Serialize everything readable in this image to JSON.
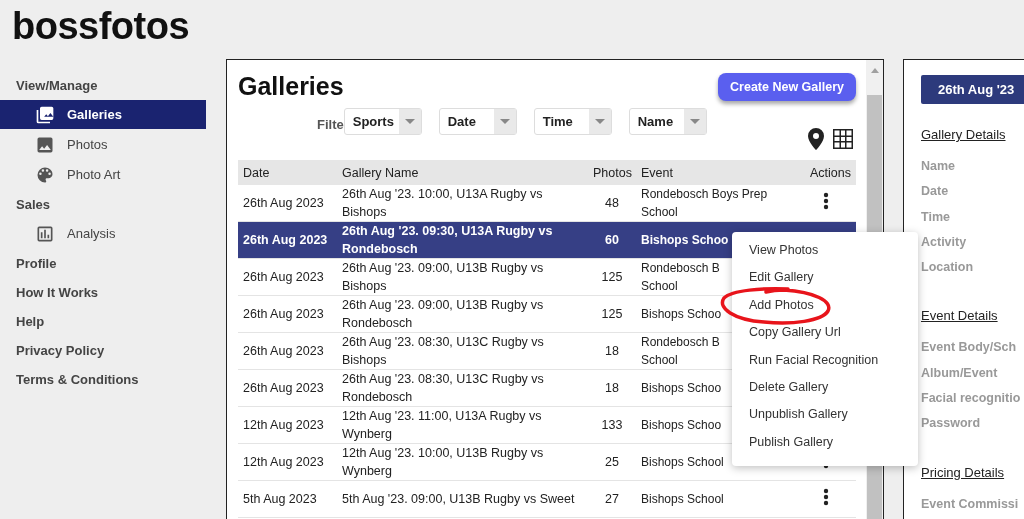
{
  "logo": "bossfotos",
  "sidebar": {
    "sections": [
      {
        "label": "View/Manage",
        "items": [
          {
            "label": "Galleries",
            "selected": true
          },
          {
            "label": "Photos",
            "selected": false
          },
          {
            "label": "Photo Art",
            "selected": false
          }
        ]
      },
      {
        "label": "Sales",
        "items": [
          {
            "label": "Analysis",
            "selected": false
          }
        ]
      },
      {
        "label": "Profile"
      },
      {
        "label": "How It Works"
      },
      {
        "label": "Help"
      },
      {
        "label": "Privacy Policy"
      },
      {
        "label": "Terms & Conditions"
      }
    ]
  },
  "main": {
    "title": "Galleries",
    "create_button": "Create New Gallery",
    "filter_label": "Filte",
    "filters": [
      "Sports",
      "Date",
      "Time",
      "Name"
    ],
    "table": {
      "columns": [
        "Date",
        "Gallery Name",
        "Photos",
        "Event",
        "Actions"
      ],
      "rows": [
        {
          "date": "26th Aug 2023",
          "name": "26th Aug '23. 10:00, U13A Rugby vs Bishops",
          "photos": "48",
          "event": "Rondebosch Boys Prep School",
          "selected": false
        },
        {
          "date": "26th Aug 2023",
          "name": "26th Aug '23. 09:30, U13A Rugby vs Rondebosch",
          "photos": "60",
          "event": "Bishops Schoo",
          "selected": true
        },
        {
          "date": "26th Aug 2023",
          "name": "26th Aug '23. 09:00, U13B Rugby vs Bishops",
          "photos": "125",
          "event": "Rondebosch B School",
          "selected": false
        },
        {
          "date": "26th Aug 2023",
          "name": "26th Aug '23. 09:00, U13B Rugby vs Rondebosch",
          "photos": "125",
          "event": "Bishops Schoo",
          "selected": false
        },
        {
          "date": "26th Aug 2023",
          "name": "26th Aug '23. 08:30, U13C Rugby vs Bishops",
          "photos": "18",
          "event": "Rondebosch B School",
          "selected": false
        },
        {
          "date": "26th Aug 2023",
          "name": "26th Aug '23. 08:30, U13C Rugby vs Rondebosch",
          "photos": "18",
          "event": "Bishops Schoo",
          "selected": false
        },
        {
          "date": "12th Aug 2023",
          "name": "12th Aug '23. 11:00, U13A Rugby vs Wynberg",
          "photos": "133",
          "event": "Bishops Schoo",
          "selected": false
        },
        {
          "date": "12th Aug 2023",
          "name": "12th Aug '23. 10:00, U13B Rugby vs Wynberg",
          "photos": "25",
          "event": "Bishops School",
          "selected": false
        },
        {
          "date": "5th Aug 2023",
          "name": "5th Aug '23. 09:00, U13B Rugby vs Sweet",
          "photos": "27",
          "event": "Bishops School",
          "selected": false
        }
      ]
    }
  },
  "context_menu": [
    "View Photos",
    "Edit Gallery",
    "Add Photos",
    "Copy Gallery Url",
    "Run Facial Recognition",
    "Delete Gallery",
    "Unpublish Gallery",
    "Publish Gallery"
  ],
  "details": {
    "date_button": "26th Aug '23",
    "sections": [
      {
        "heading": "Gallery Details",
        "labels": [
          "Name",
          "Date",
          "Time",
          "Activity",
          "Location"
        ]
      },
      {
        "heading": "Event Details",
        "labels": [
          "Event Body/Sch",
          "Album/Event",
          "Facial recognitio",
          "Password"
        ]
      },
      {
        "heading": "Pricing Details",
        "labels": [
          "Event Commissi"
        ]
      }
    ]
  }
}
